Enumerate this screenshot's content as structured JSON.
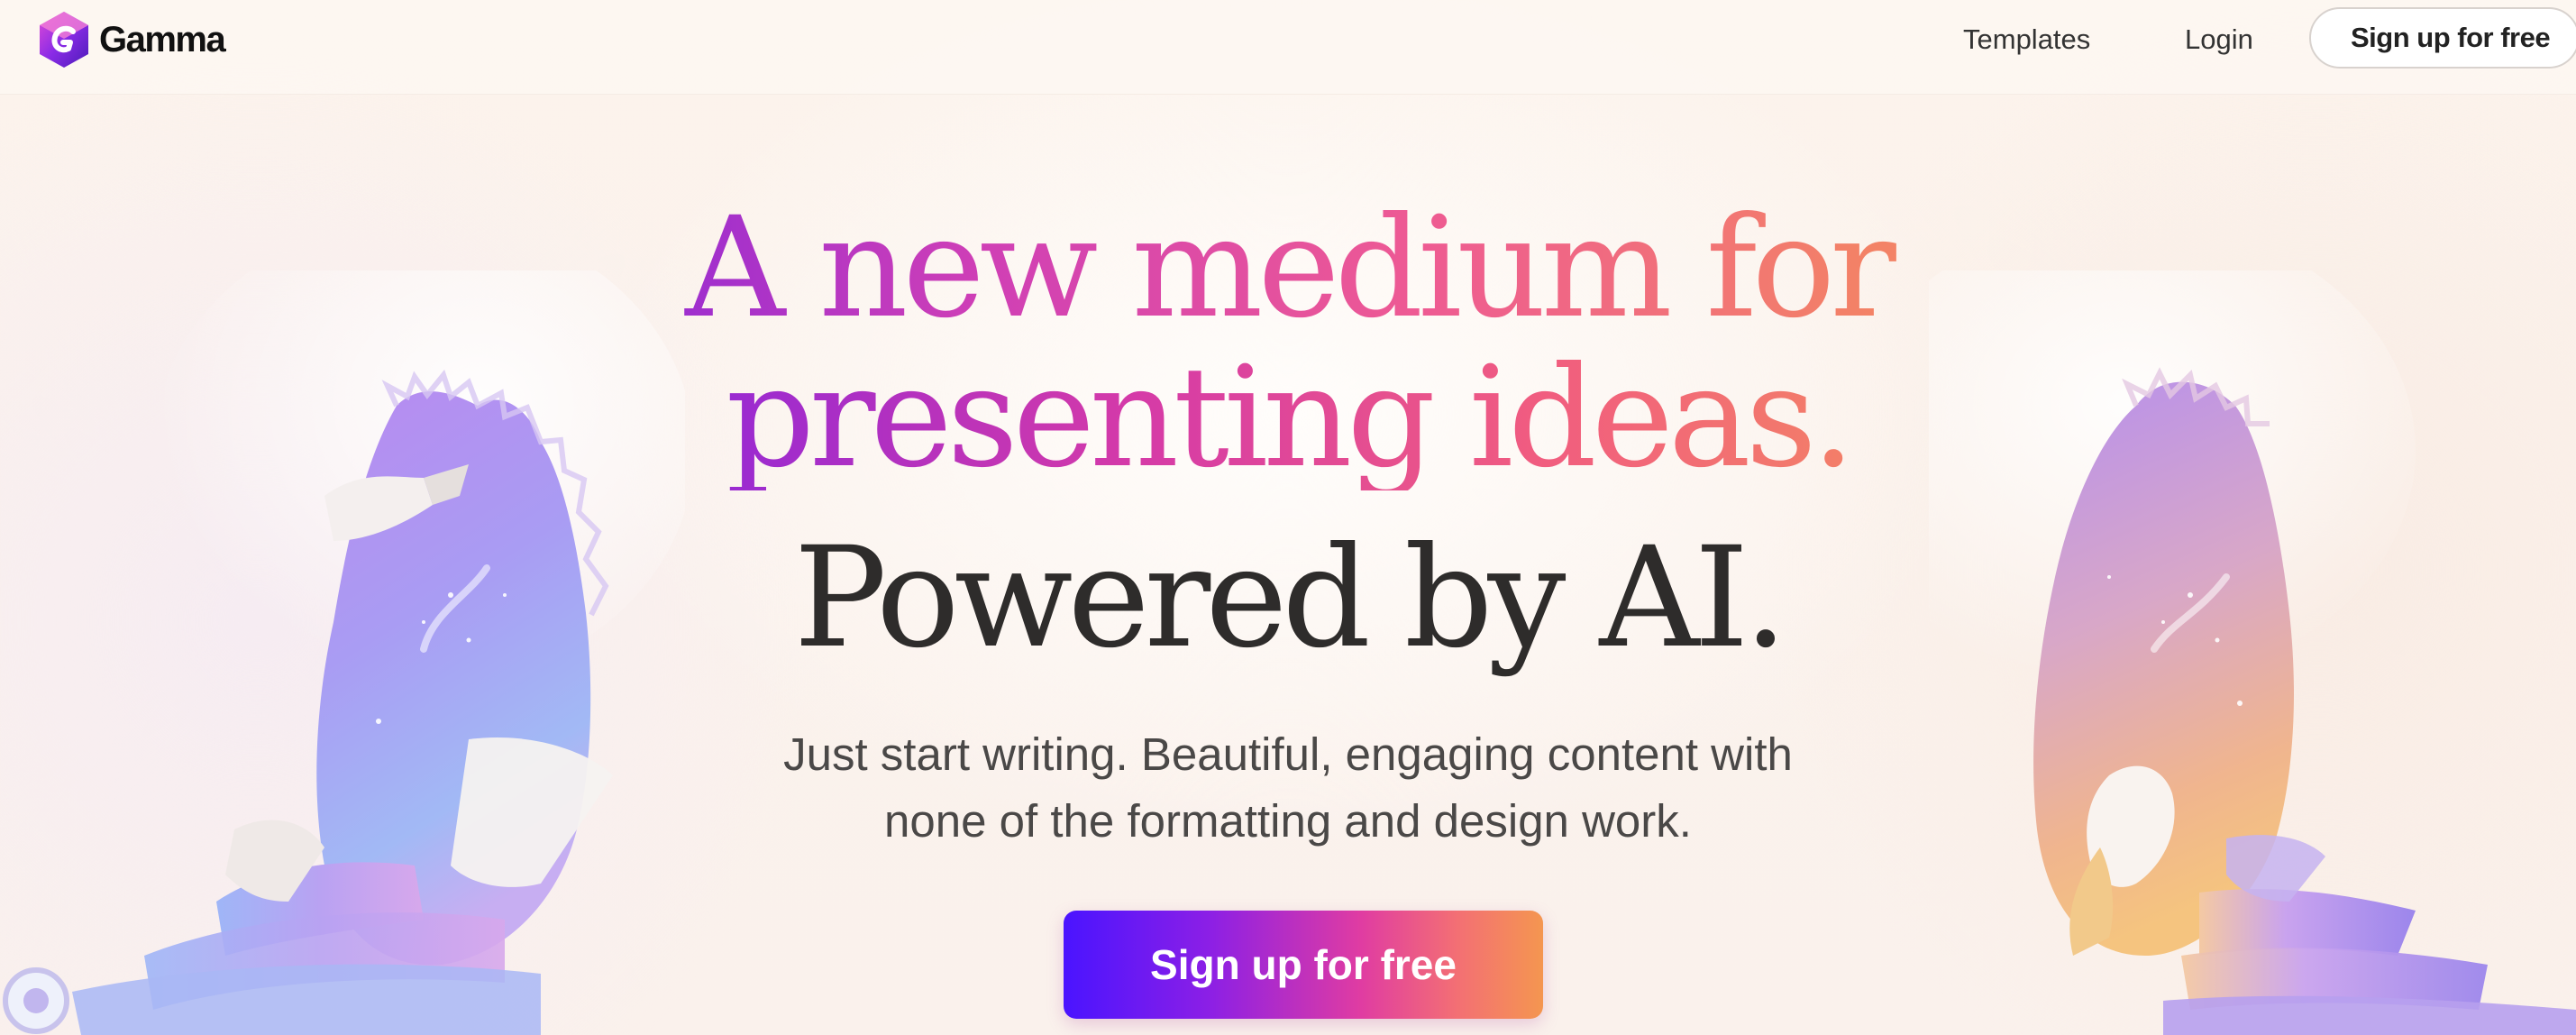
{
  "nav": {
    "brand": "Gamma",
    "links": [
      {
        "label": "Templates"
      },
      {
        "label": "Login"
      }
    ],
    "signup_label": "Sign up for free"
  },
  "hero": {
    "headline_line1": "A new medium for",
    "headline_line2": "presenting ideas.",
    "headline_line3": "Powered by AI.",
    "subtitle_line1": "Just start writing. Beautiful, engaging content with",
    "subtitle_line2": "none of the formatting and design work.",
    "cta_label": "Sign up for free"
  },
  "colors": {
    "gradient_start": "#3b16ff",
    "gradient_mid": "#e03ca2",
    "gradient_end": "#f5a24c",
    "text_dark": "#2e2c2b",
    "text_body": "#4a4847"
  },
  "icons": {
    "logo": "gamma-logo-icon"
  }
}
